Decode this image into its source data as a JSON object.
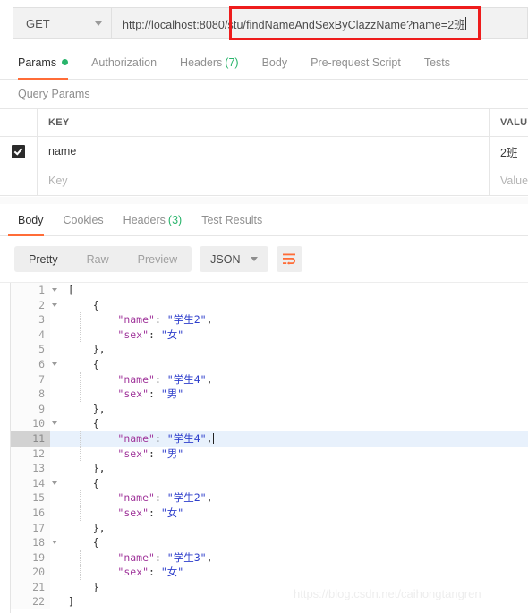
{
  "request_bar": {
    "method": "GET",
    "url": "http://localhost:8080/stu/findNameAndSexByClazzName?name=2班",
    "annotation_color": "#ee1c1c"
  },
  "request_tabs": [
    {
      "label": "Params",
      "badge": "",
      "dot": true,
      "active": true
    },
    {
      "label": "Authorization",
      "badge": "",
      "dot": false,
      "active": false
    },
    {
      "label": "Headers",
      "badge": "(7)",
      "dot": false,
      "active": false
    },
    {
      "label": "Body",
      "badge": "",
      "dot": false,
      "active": false
    },
    {
      "label": "Pre-request Script",
      "badge": "",
      "dot": false,
      "active": false
    },
    {
      "label": "Tests",
      "badge": "",
      "dot": false,
      "active": false
    }
  ],
  "query_params": {
    "section_label": "Query Params",
    "columns": {
      "key": "KEY",
      "value": "VALUE"
    },
    "rows": [
      {
        "checked": true,
        "key": "name",
        "value": "2班"
      }
    ],
    "placeholder_row": {
      "key": "Key",
      "value": "Value"
    }
  },
  "response_tabs": [
    {
      "label": "Body",
      "badge": "",
      "active": true
    },
    {
      "label": "Cookies",
      "badge": "",
      "active": false
    },
    {
      "label": "Headers",
      "badge": "(3)",
      "active": false
    },
    {
      "label": "Test Results",
      "badge": "",
      "active": false
    }
  ],
  "view_toolbar": {
    "views": [
      {
        "label": "Pretty",
        "active": true
      },
      {
        "label": "Raw",
        "active": false
      },
      {
        "label": "Preview",
        "active": false
      }
    ],
    "format": "JSON",
    "wrap_icon": "word-wrap-icon",
    "accent": "#ff6c37"
  },
  "body_editor": {
    "highlighted_line": 11,
    "lines": [
      {
        "n": 1,
        "fold": true,
        "indent": 0,
        "segments": [
          {
            "t": "[",
            "c": "p"
          }
        ]
      },
      {
        "n": 2,
        "fold": true,
        "indent": 1,
        "segments": [
          {
            "t": "{",
            "c": "p"
          }
        ]
      },
      {
        "n": 3,
        "fold": false,
        "indent": 2,
        "segments": [
          {
            "t": "\"name\"",
            "c": "k"
          },
          {
            "t": ": ",
            "c": "p"
          },
          {
            "t": "\"学生2\"",
            "c": "v"
          },
          {
            "t": ",",
            "c": "p"
          }
        ]
      },
      {
        "n": 4,
        "fold": false,
        "indent": 2,
        "segments": [
          {
            "t": "\"sex\"",
            "c": "k"
          },
          {
            "t": ": ",
            "c": "p"
          },
          {
            "t": "\"女\"",
            "c": "v"
          }
        ]
      },
      {
        "n": 5,
        "fold": false,
        "indent": 1,
        "segments": [
          {
            "t": "},",
            "c": "p"
          }
        ]
      },
      {
        "n": 6,
        "fold": true,
        "indent": 1,
        "segments": [
          {
            "t": "{",
            "c": "p"
          }
        ]
      },
      {
        "n": 7,
        "fold": false,
        "indent": 2,
        "segments": [
          {
            "t": "\"name\"",
            "c": "k"
          },
          {
            "t": ": ",
            "c": "p"
          },
          {
            "t": "\"学生4\"",
            "c": "v"
          },
          {
            "t": ",",
            "c": "p"
          }
        ]
      },
      {
        "n": 8,
        "fold": false,
        "indent": 2,
        "segments": [
          {
            "t": "\"sex\"",
            "c": "k"
          },
          {
            "t": ": ",
            "c": "p"
          },
          {
            "t": "\"男\"",
            "c": "v"
          }
        ]
      },
      {
        "n": 9,
        "fold": false,
        "indent": 1,
        "segments": [
          {
            "t": "},",
            "c": "p"
          }
        ]
      },
      {
        "n": 10,
        "fold": true,
        "indent": 1,
        "segments": [
          {
            "t": "{",
            "c": "p"
          }
        ]
      },
      {
        "n": 11,
        "fold": false,
        "indent": 2,
        "caret": true,
        "segments": [
          {
            "t": "\"name\"",
            "c": "k"
          },
          {
            "t": ": ",
            "c": "p"
          },
          {
            "t": "\"学生4\"",
            "c": "v"
          },
          {
            "t": ",",
            "c": "p"
          }
        ]
      },
      {
        "n": 12,
        "fold": false,
        "indent": 2,
        "segments": [
          {
            "t": "\"sex\"",
            "c": "k"
          },
          {
            "t": ": ",
            "c": "p"
          },
          {
            "t": "\"男\"",
            "c": "v"
          }
        ]
      },
      {
        "n": 13,
        "fold": false,
        "indent": 1,
        "segments": [
          {
            "t": "},",
            "c": "p"
          }
        ]
      },
      {
        "n": 14,
        "fold": true,
        "indent": 1,
        "segments": [
          {
            "t": "{",
            "c": "p"
          }
        ]
      },
      {
        "n": 15,
        "fold": false,
        "indent": 2,
        "segments": [
          {
            "t": "\"name\"",
            "c": "k"
          },
          {
            "t": ": ",
            "c": "p"
          },
          {
            "t": "\"学生2\"",
            "c": "v"
          },
          {
            "t": ",",
            "c": "p"
          }
        ]
      },
      {
        "n": 16,
        "fold": false,
        "indent": 2,
        "segments": [
          {
            "t": "\"sex\"",
            "c": "k"
          },
          {
            "t": ": ",
            "c": "p"
          },
          {
            "t": "\"女\"",
            "c": "v"
          }
        ]
      },
      {
        "n": 17,
        "fold": false,
        "indent": 1,
        "segments": [
          {
            "t": "},",
            "c": "p"
          }
        ]
      },
      {
        "n": 18,
        "fold": true,
        "indent": 1,
        "segments": [
          {
            "t": "{",
            "c": "p"
          }
        ]
      },
      {
        "n": 19,
        "fold": false,
        "indent": 2,
        "segments": [
          {
            "t": "\"name\"",
            "c": "k"
          },
          {
            "t": ": ",
            "c": "p"
          },
          {
            "t": "\"学生3\"",
            "c": "v"
          },
          {
            "t": ",",
            "c": "p"
          }
        ]
      },
      {
        "n": 20,
        "fold": false,
        "indent": 2,
        "segments": [
          {
            "t": "\"sex\"",
            "c": "k"
          },
          {
            "t": ": ",
            "c": "p"
          },
          {
            "t": "\"女\"",
            "c": "v"
          }
        ]
      },
      {
        "n": 21,
        "fold": false,
        "indent": 1,
        "segments": [
          {
            "t": "}",
            "c": "p"
          }
        ]
      },
      {
        "n": 22,
        "fold": false,
        "indent": 0,
        "segments": [
          {
            "t": "]",
            "c": "p"
          }
        ]
      }
    ]
  },
  "watermark": "https://blog.csdn.net/caihongtangren"
}
